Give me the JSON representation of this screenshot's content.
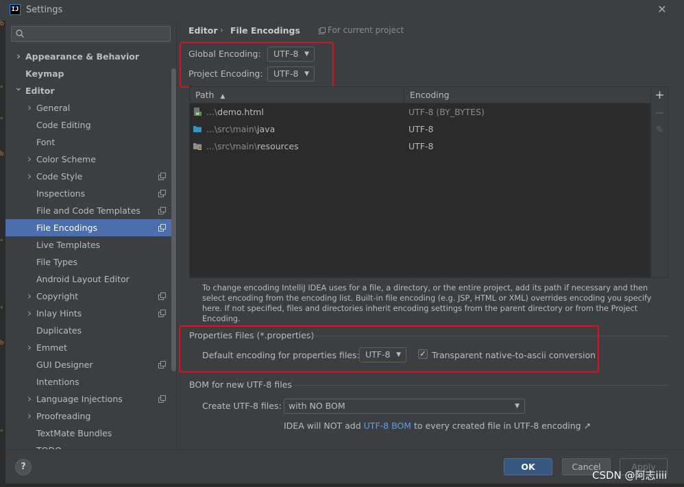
{
  "window": {
    "title": "Settings",
    "app_icon": "IJ"
  },
  "search": {
    "value": "",
    "placeholder": ""
  },
  "sidebar": {
    "items": [
      {
        "label": "Appearance & Behavior",
        "level": 0,
        "expandable": true,
        "expanded": false,
        "bold": true,
        "project_icon": false,
        "selected": false
      },
      {
        "label": "Keymap",
        "level": 0,
        "expandable": false,
        "expanded": false,
        "bold": true,
        "project_icon": false,
        "selected": false
      },
      {
        "label": "Editor",
        "level": 0,
        "expandable": true,
        "expanded": true,
        "bold": true,
        "project_icon": false,
        "selected": false
      },
      {
        "label": "General",
        "level": 1,
        "expandable": true,
        "expanded": false,
        "bold": false,
        "project_icon": false,
        "selected": false
      },
      {
        "label": "Code Editing",
        "level": 1,
        "expandable": false,
        "expanded": false,
        "bold": false,
        "project_icon": false,
        "selected": false
      },
      {
        "label": "Font",
        "level": 1,
        "expandable": false,
        "expanded": false,
        "bold": false,
        "project_icon": false,
        "selected": false
      },
      {
        "label": "Color Scheme",
        "level": 1,
        "expandable": true,
        "expanded": false,
        "bold": false,
        "project_icon": false,
        "selected": false
      },
      {
        "label": "Code Style",
        "level": 1,
        "expandable": true,
        "expanded": false,
        "bold": false,
        "project_icon": true,
        "selected": false
      },
      {
        "label": "Inspections",
        "level": 1,
        "expandable": false,
        "expanded": false,
        "bold": false,
        "project_icon": true,
        "selected": false
      },
      {
        "label": "File and Code Templates",
        "level": 1,
        "expandable": false,
        "expanded": false,
        "bold": false,
        "project_icon": true,
        "selected": false
      },
      {
        "label": "File Encodings",
        "level": 1,
        "expandable": false,
        "expanded": false,
        "bold": false,
        "project_icon": true,
        "selected": true
      },
      {
        "label": "Live Templates",
        "level": 1,
        "expandable": false,
        "expanded": false,
        "bold": false,
        "project_icon": false,
        "selected": false
      },
      {
        "label": "File Types",
        "level": 1,
        "expandable": false,
        "expanded": false,
        "bold": false,
        "project_icon": false,
        "selected": false
      },
      {
        "label": "Android Layout Editor",
        "level": 1,
        "expandable": false,
        "expanded": false,
        "bold": false,
        "project_icon": false,
        "selected": false
      },
      {
        "label": "Copyright",
        "level": 1,
        "expandable": true,
        "expanded": false,
        "bold": false,
        "project_icon": true,
        "selected": false
      },
      {
        "label": "Inlay Hints",
        "level": 1,
        "expandable": true,
        "expanded": false,
        "bold": false,
        "project_icon": true,
        "selected": false
      },
      {
        "label": "Duplicates",
        "level": 1,
        "expandable": false,
        "expanded": false,
        "bold": false,
        "project_icon": false,
        "selected": false
      },
      {
        "label": "Emmet",
        "level": 1,
        "expandable": true,
        "expanded": false,
        "bold": false,
        "project_icon": false,
        "selected": false
      },
      {
        "label": "GUI Designer",
        "level": 1,
        "expandable": false,
        "expanded": false,
        "bold": false,
        "project_icon": true,
        "selected": false
      },
      {
        "label": "Intentions",
        "level": 1,
        "expandable": false,
        "expanded": false,
        "bold": false,
        "project_icon": false,
        "selected": false
      },
      {
        "label": "Language Injections",
        "level": 1,
        "expandable": true,
        "expanded": false,
        "bold": false,
        "project_icon": true,
        "selected": false
      },
      {
        "label": "Proofreading",
        "level": 1,
        "expandable": true,
        "expanded": false,
        "bold": false,
        "project_icon": false,
        "selected": false
      },
      {
        "label": "TextMate Bundles",
        "level": 1,
        "expandable": false,
        "expanded": false,
        "bold": false,
        "project_icon": false,
        "selected": false
      },
      {
        "label": "TODO",
        "level": 1,
        "expandable": false,
        "expanded": false,
        "bold": false,
        "project_icon": false,
        "selected": false
      }
    ]
  },
  "breadcrumb": {
    "parent": "Editor",
    "separator": "›",
    "current": "File Encodings",
    "project_note": "For current project"
  },
  "encoding": {
    "global_label": "Global Encoding:",
    "global_value": "UTF-8",
    "project_label": "Project Encoding:",
    "project_value": "UTF-8"
  },
  "table": {
    "col_path": "Path",
    "sort_arrow": "▲",
    "col_encoding": "Encoding",
    "rows": [
      {
        "path_prefix": "...\\",
        "path_name": "demo.html",
        "encoding": "UTF-8 (BY_BYTES)",
        "dimmed": true,
        "icon": "html-file-icon"
      },
      {
        "path_prefix": "...\\src\\main\\",
        "path_name": "java",
        "encoding": "UTF-8",
        "dimmed": false,
        "icon": "folder-icon"
      },
      {
        "path_prefix": "...\\src\\main\\",
        "path_name": "resources",
        "encoding": "UTF-8",
        "dimmed": false,
        "icon": "resources-folder-icon"
      }
    ],
    "tools": {
      "add": "+",
      "remove": "−",
      "edit": "✎"
    }
  },
  "hint": "To change encoding IntelliJ IDEA uses for a file, a directory, or the entire project, add its path if necessary and then select encoding from the encoding list. Built-in file encoding (e.g. JSP, HTML or XML) overrides encoding you specify here. If not specified, files and directories inherit encoding settings from the parent directory or from the Project Encoding.",
  "properties": {
    "title": "Properties Files (*.properties)",
    "default_label": "Default encoding for properties files:",
    "default_value": "UTF-8",
    "transparent_checked": true,
    "check_mark": "✓",
    "transparent_label": "Transparent native-to-ascii conversion"
  },
  "bom": {
    "title": "BOM for new UTF-8 files",
    "create_label": "Create UTF-8 files:",
    "create_value": "with NO BOM",
    "note_prefix": "IDEA will NOT add ",
    "note_link": "UTF-8 BOM",
    "note_suffix": " to every created file in UTF-8 encoding ↗"
  },
  "buttons": {
    "help": "?",
    "ok": "OK",
    "cancel": "Cancel",
    "apply": "Apply"
  },
  "watermark": "CSDN @阿志iiii",
  "colors": {
    "selection": "#4b6eaf",
    "highlight_box": "#e0101a",
    "link": "#589df6",
    "ok_button": "#365880"
  }
}
